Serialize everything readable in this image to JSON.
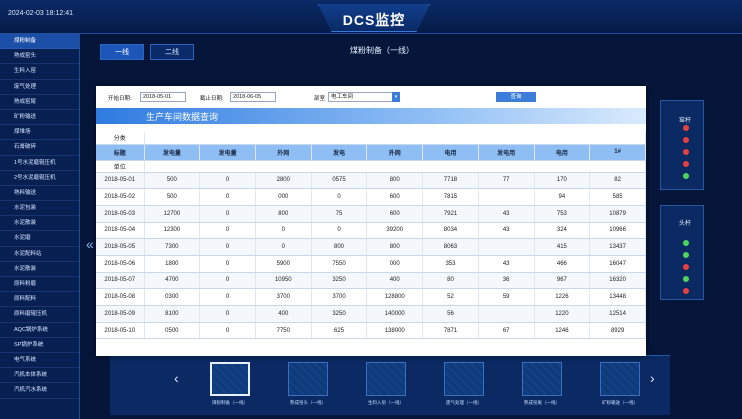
{
  "header": {
    "timestamp": "2024-02-03 18:12:41",
    "title": "DCS监控"
  },
  "sidebar": {
    "items": [
      {
        "label": "煤粉制备",
        "active": true
      },
      {
        "label": "熟成窑头"
      },
      {
        "label": "生料入窑"
      },
      {
        "label": "废气处理"
      },
      {
        "label": "熟成窑尾"
      },
      {
        "label": "矿粉输送"
      },
      {
        "label": "煤堆场"
      },
      {
        "label": "石膏破碎"
      },
      {
        "label": "1号水泥磨辊压机"
      },
      {
        "label": "2号水泥磨辊压机"
      },
      {
        "label": "熟料输送"
      },
      {
        "label": "水泥包装"
      },
      {
        "label": "水泥散装"
      },
      {
        "label": "水泥磨"
      },
      {
        "label": "水泥配料站"
      },
      {
        "label": "水泥散装"
      },
      {
        "label": "原料粉磨"
      },
      {
        "label": "原料配料"
      },
      {
        "label": "原料磨辊压机"
      },
      {
        "label": "AQC锅炉系统"
      },
      {
        "label": "SP锅炉系统"
      },
      {
        "label": "电气系统"
      },
      {
        "label": "汽机本体系统"
      },
      {
        "label": "汽机汽水系统"
      }
    ]
  },
  "page": {
    "tabs": [
      {
        "label": "一线",
        "active": true
      },
      {
        "label": "二线"
      }
    ],
    "title": "煤粉制备（一线）",
    "right_panel_labels": [
      "窑杆",
      "头杆"
    ]
  },
  "dialog": {
    "start_label": "开始日期:",
    "start_value": "2018-05-01",
    "end_label": "截止日期:",
    "end_value": "2018-06-05",
    "dept_label": "部室",
    "dept_value": "电工车间",
    "query_label": "查询",
    "banner": "生产车间数据查询",
    "category_label": "分类",
    "title_label": "标题",
    "unit_label": "单位",
    "column_headers": [
      "",
      "发电量",
      "发电量",
      "外网",
      "发电",
      "外网",
      "电用",
      "发电用",
      "电用",
      "1#"
    ],
    "rows": [
      [
        "2018-05-01",
        "500",
        "0",
        "2800",
        "0575",
        "800",
        "7718",
        "77",
        "170",
        "82"
      ],
      [
        "2018-05-02",
        "500",
        "0",
        "000",
        "0",
        "600",
        "7815",
        "",
        "94",
        "585"
      ],
      [
        "2018-05-03",
        "12700",
        "0",
        "800",
        "75",
        "600",
        "7921",
        "43",
        "753",
        "10879"
      ],
      [
        "2018-05-04",
        "12300",
        "0",
        "0",
        "0",
        "39200",
        "8034",
        "43",
        "324",
        "10966"
      ],
      [
        "2018-05-05",
        "7300",
        "0",
        "0",
        "800",
        "800",
        "8063",
        "",
        "415",
        "13437"
      ],
      [
        "2018-05-06",
        "1800",
        "0",
        "5900",
        "7550",
        "000",
        "353",
        "43",
        "466",
        "16047"
      ],
      [
        "2018-05-07",
        "4700",
        "0",
        "10950",
        "3250",
        "400",
        "80",
        "36",
        "967",
        "16320"
      ],
      [
        "2018-05-08",
        "0300",
        "0",
        "3700",
        "3700",
        "128800",
        "52",
        "59",
        "1226",
        "13448"
      ],
      [
        "2018-05-09",
        "8100",
        "0",
        "400",
        "3250",
        "140000",
        "56",
        "",
        "1220",
        "12514"
      ],
      [
        "2018-05-10",
        "0500",
        "0",
        "7750",
        "625",
        "138000",
        "7871",
        "67",
        "1246",
        "8929"
      ]
    ]
  },
  "carousel": {
    "items": [
      "煤粉制备（一线）",
      "熟成窑头（一线）",
      "生料入窑（一线）",
      "废气处理（一线）",
      "熟成窑尾（一线）",
      "矿粉输送（一线）"
    ]
  },
  "colors": {
    "background": "#06163a",
    "panel": "#0b2a63",
    "accent": "#3b7dd8",
    "table_header": "#8fbef5"
  }
}
